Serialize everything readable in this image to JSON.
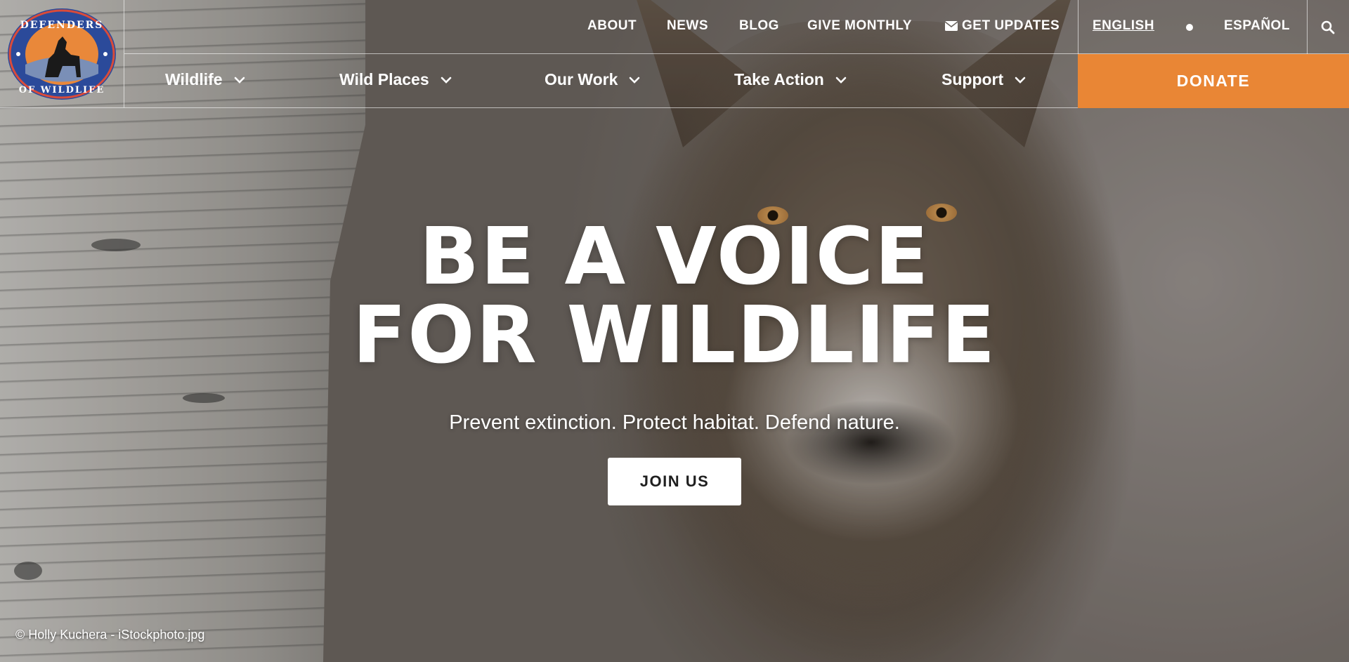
{
  "brand": {
    "logo_alt": "DEFENDERS OF WILDLIFE",
    "logo_top_text": "DEFENDERS",
    "logo_bottom_text": "OF WILDLIFE"
  },
  "utility_nav": {
    "about": "ABOUT",
    "news": "NEWS",
    "blog": "BLOG",
    "give_monthly": "GIVE MONTHLY",
    "get_updates": "GET UPDATES",
    "lang_english": "ENGLISH",
    "lang_spanish": "ESPAÑOL"
  },
  "main_nav": {
    "items": [
      {
        "label": "Wildlife"
      },
      {
        "label": "Wild Places"
      },
      {
        "label": "Our Work"
      },
      {
        "label": "Take Action"
      },
      {
        "label": "Support"
      }
    ],
    "donate_label": "DONATE"
  },
  "hero": {
    "title_line1": "BE A VOICE",
    "title_line2": "FOR WILDLIFE",
    "subtitle": "Prevent extinction. Protect habitat. Defend nature.",
    "cta_label": "JOIN US",
    "photo_credit": "© Holly Kuchera - iStockphoto.jpg"
  },
  "colors": {
    "donate": "#e98635",
    "logo_ring": "#2b4a9a",
    "logo_sunset": "#e9883a"
  },
  "icons": {
    "envelope": "envelope-icon",
    "search": "search-icon",
    "chevron": "chevron-down-icon"
  }
}
